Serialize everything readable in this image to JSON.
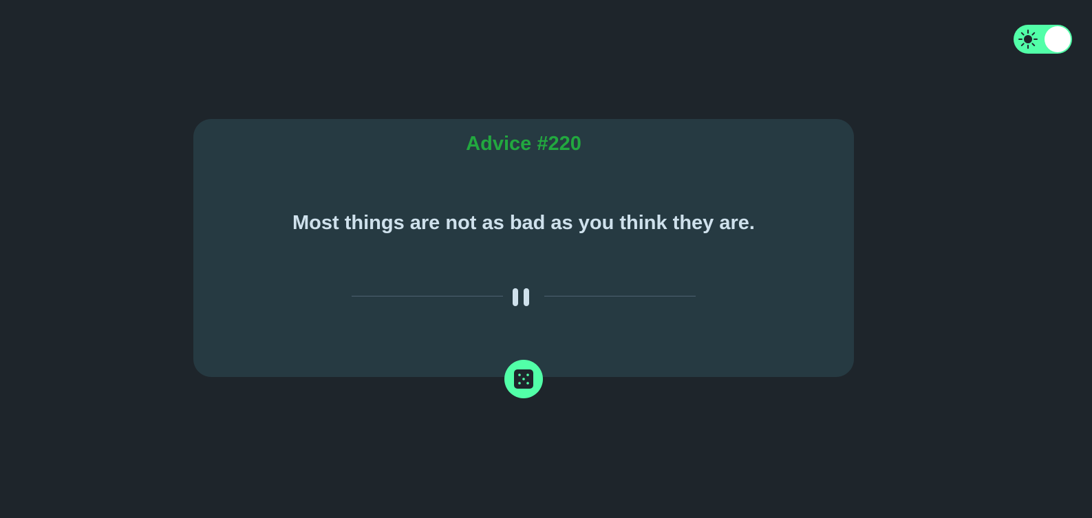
{
  "theme_toggle": {
    "icon": "sun-icon",
    "state": "on",
    "accent": "#52ffa8"
  },
  "advice": {
    "title": "Advice #220",
    "text": "Most things are not as bad as you think they are.",
    "title_color": "#22a83f",
    "divider_icon": "pause-icon"
  },
  "dice_button": {
    "icon": "dice-icon",
    "color": "#52ffa8"
  },
  "colors": {
    "background": "#1e252b",
    "card": "#263a42",
    "text": "#cfe1ec"
  }
}
